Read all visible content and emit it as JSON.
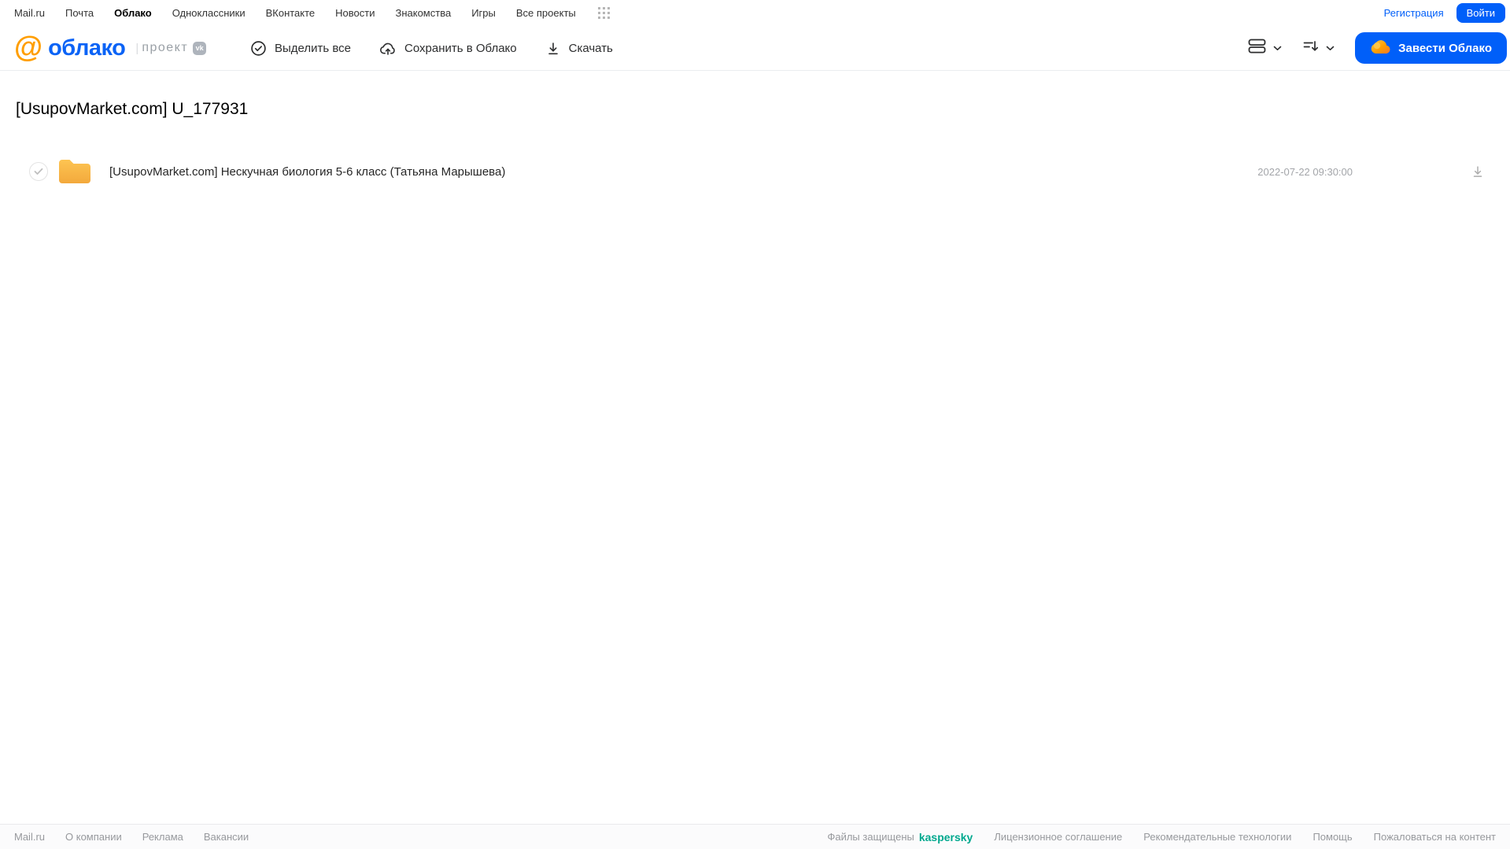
{
  "top_nav": {
    "links": [
      "Mail.ru",
      "Почта",
      "Облако",
      "Одноклассники",
      "ВКонтакте",
      "Новости",
      "Знакомства",
      "Игры",
      "Все проекты"
    ],
    "registration_label": "Регистрация",
    "login_label": "Войти"
  },
  "header": {
    "logo": {
      "at_symbol": "@",
      "product_name": "облако",
      "divider": "|",
      "project_label": "проект",
      "vk_badge": "vk"
    },
    "toolbar": {
      "select_all_label": "Выделить все",
      "save_to_cloud_label": "Сохранить в Облако",
      "download_label": "Скачать"
    },
    "create_cloud_label": "Завести Облако"
  },
  "content": {
    "page_title": "[UsupovMarket.com] U_177931",
    "files": [
      {
        "type": "folder",
        "name": "[UsupovMarket.com] Нескучная биология 5-6 класс (Татьяна Марышева)",
        "date": "2022-07-22 09:30:00"
      }
    ]
  },
  "footer": {
    "left_links": [
      "Mail.ru",
      "О компании",
      "Реклама",
      "Вакансии"
    ],
    "protection_text": "Файлы защищены",
    "kaspersky_label": "kaspersky",
    "right_links": [
      "Лицензионное соглашение",
      "Рекомендательные технологии",
      "Помощь",
      "Пожаловаться на контент"
    ]
  },
  "colors": {
    "brand_blue": "#005ff9",
    "brand_orange": "#ff9e00",
    "folder_yellow": "#f7b942",
    "kaspersky_green": "#00a88e"
  }
}
